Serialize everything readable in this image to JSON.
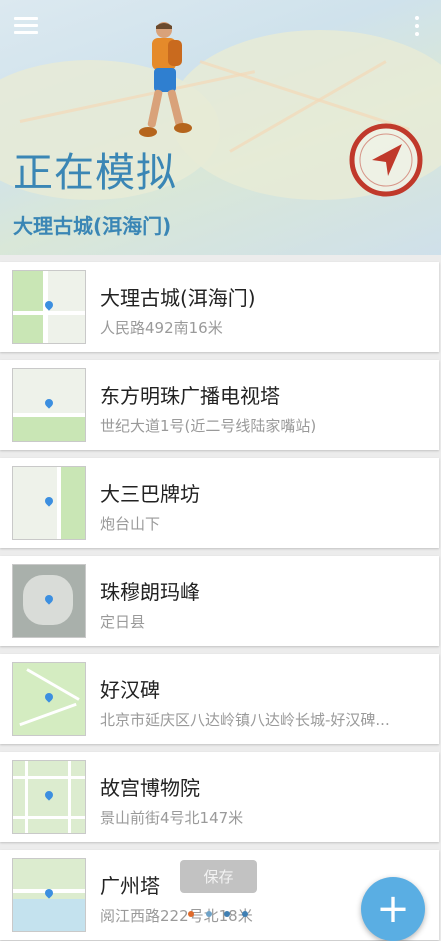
{
  "header": {
    "title": "正在模拟",
    "subtitle": "大理古城(洱海门)"
  },
  "locations": [
    {
      "name": "大理古城(洱海门)",
      "address": "人民路492南16米"
    },
    {
      "name": "东方明珠广播电视塔",
      "address": "世纪大道1号(近二号线陆家嘴站)"
    },
    {
      "name": "大三巴牌坊",
      "address": "炮台山下"
    },
    {
      "name": "珠穆朗玛峰",
      "address": "定日县"
    },
    {
      "name": "好汉碑",
      "address": "北京市延庆区八达岭镇八达岭长城-好汉碑..."
    },
    {
      "name": "故宫博物院",
      "address": "景山前街4号北147米"
    },
    {
      "name": "广州塔",
      "address": "阅江西路222号北18米"
    }
  ],
  "save_label": "保存",
  "add_label": "+",
  "colors": {
    "accent": "#3a86b5",
    "fab": "#5aaee3",
    "compass": "#c0392b"
  }
}
